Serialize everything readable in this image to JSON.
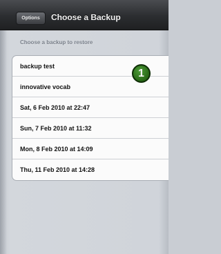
{
  "nav": {
    "back_label": "Options",
    "title": "Choose a Backup"
  },
  "section_header": "Choose a backup to restore",
  "backups": [
    {
      "label": "backup test"
    },
    {
      "label": "innovative vocab"
    },
    {
      "label": "Sat, 6 Feb 2010 at 22:47"
    },
    {
      "label": "Sun, 7 Feb 2010 at 11:32"
    },
    {
      "label": "Mon, 8 Feb 2010 at 14:09"
    },
    {
      "label": "Thu, 11 Feb 2010 at 14:28"
    }
  ],
  "callout": {
    "number": "1",
    "color": "#2f7a1f"
  }
}
